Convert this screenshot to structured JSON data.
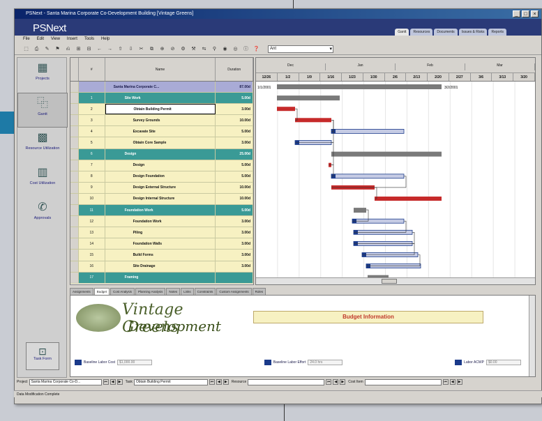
{
  "window": {
    "title": "PSNext - Santa Marina Corporate Co-Development Building [Vintage Greens]",
    "controls": [
      "_",
      "□",
      "×"
    ]
  },
  "brand": {
    "logo": "PSNext",
    "tabs": [
      "Gantt",
      "Resources",
      "Documents",
      "Issues & Risks",
      "Reports"
    ]
  },
  "menu": [
    "File",
    "Edit",
    "View",
    "Insert",
    "Tools",
    "Help"
  ],
  "toolbar": {
    "icons": [
      "⬚",
      "⎙",
      "✎",
      "⚑",
      "⎌",
      "⊞",
      "⊟",
      "←",
      "→",
      "⇧",
      "⇩",
      "✂",
      "⧉",
      "⊕",
      "⊘",
      "⚙",
      "⚒",
      "⇆",
      "⚲",
      "◉",
      "◎",
      "ⓘ",
      "❓"
    ],
    "combo_value": "Ant"
  },
  "sidebar": {
    "items": [
      {
        "icon": "▦",
        "label": "Projects"
      },
      {
        "icon": "⿻",
        "label": "Gantt"
      },
      {
        "icon": "▩",
        "label": "Resource Utilization"
      },
      {
        "icon": "▥",
        "label": "Cost Utilization"
      },
      {
        "icon": "✆",
        "label": "Approvals"
      }
    ],
    "bottom": {
      "icon": "⊡",
      "label": "Task Form"
    }
  },
  "grid": {
    "headers": [
      "#",
      "Name",
      "Duration"
    ],
    "rows": [
      {
        "kind": "project",
        "num": "",
        "name": "Santa Marina Corporate C...",
        "dur": "87.00d"
      },
      {
        "kind": "summary",
        "num": "1",
        "name": "Site Work",
        "dur": "5.00d"
      },
      {
        "kind": "task",
        "num": "2",
        "name": "Obtain Building Permit",
        "dur": "3.00d",
        "selected": true
      },
      {
        "kind": "task",
        "num": "3",
        "name": "Survey Grounds",
        "dur": "10.00d"
      },
      {
        "kind": "task",
        "num": "4",
        "name": "Excavate Site",
        "dur": "5.00d"
      },
      {
        "kind": "task",
        "num": "5",
        "name": "Obtain Core Sample",
        "dur": "3.00d"
      },
      {
        "kind": "summary",
        "num": "6",
        "name": "Design",
        "dur": "25.00d"
      },
      {
        "kind": "task",
        "num": "7",
        "name": "Design",
        "dur": "5.00d"
      },
      {
        "kind": "task",
        "num": "8",
        "name": "Design Foundation",
        "dur": "5.00d"
      },
      {
        "kind": "task",
        "num": "9",
        "name": "Design External Structure",
        "dur": "10.00d"
      },
      {
        "kind": "task",
        "num": "10",
        "name": "Design Internal Structure",
        "dur": "10.00d"
      },
      {
        "kind": "summary",
        "num": "11",
        "name": "Foundation Work",
        "dur": "5.00d"
      },
      {
        "kind": "task",
        "num": "12",
        "name": "Foundation Work",
        "dur": "3.00d"
      },
      {
        "kind": "task",
        "num": "13",
        "name": "Piling",
        "dur": "3.00d"
      },
      {
        "kind": "task",
        "num": "14",
        "name": "Foundation Walls",
        "dur": "3.00d"
      },
      {
        "kind": "task",
        "num": "15",
        "name": "Build Forms",
        "dur": "3.00d"
      },
      {
        "kind": "task",
        "num": "16",
        "name": "Site Drainage",
        "dur": "3.00d"
      },
      {
        "kind": "summary",
        "num": "17",
        "name": "Framing",
        "dur": ""
      }
    ]
  },
  "gantt": {
    "months": [
      "Dec",
      "Jan",
      "Feb",
      "Mar"
    ],
    "weeks": [
      "12/26",
      "1/2",
      "1/9",
      "1/16",
      "1/23",
      "1/30",
      "2/6",
      "2/13",
      "2/20",
      "2/27",
      "3/6",
      "3/13",
      "3/20"
    ],
    "start_label": "1/1/2001",
    "end_label": "3/2/2001",
    "bar_colors": {
      "summary": "#7a7a7a",
      "critical": "#c62a2a",
      "normal": "#c5cbe4",
      "normal_edge": "#1a3a8a"
    }
  },
  "detail_tabs": [
    "Assignments",
    "Budget",
    "Cost Analysis",
    "Planning Analysis",
    "Notes",
    "Links",
    "Constraints",
    "Custom Assignments",
    "Roles"
  ],
  "detail": {
    "brand_line1": "Vintage Greens",
    "brand_line2": "Development",
    "budget_title": "Budget Information",
    "fields": [
      {
        "label": "Baseline Labor Cost",
        "value": "$1,000.00"
      },
      {
        "label": "Baseline Labor Effort",
        "value": "24.0 hrs"
      },
      {
        "label": "Labor ACWP",
        "value": "$0.00"
      }
    ]
  },
  "navbar": {
    "project_label": "Project",
    "project_value": "Santa Marina Corporate Co-D...",
    "task_label": "Task",
    "task_value": "Obtain Building Permit",
    "resource_label": "Resource",
    "resource_value": "",
    "costitem_label": "Cost Item",
    "costitem_value": ""
  },
  "status": "Data Modification Complete"
}
